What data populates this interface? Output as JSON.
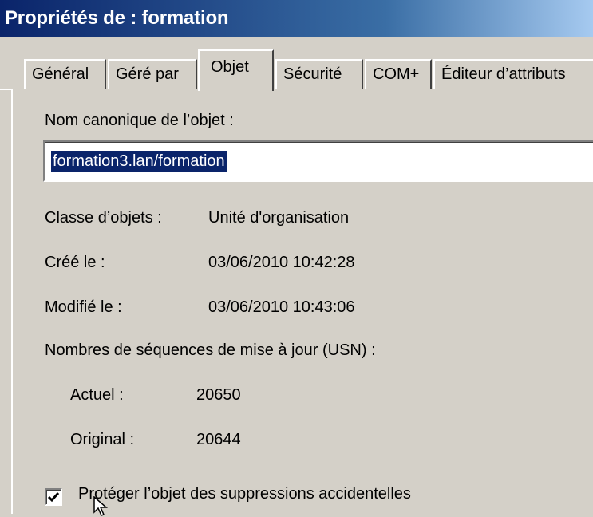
{
  "window": {
    "title": "Propriétés de : formation"
  },
  "tabs": [
    {
      "label": "Général"
    },
    {
      "label": "Géré par"
    },
    {
      "label": "Objet"
    },
    {
      "label": "Sécurité"
    },
    {
      "label": "COM+"
    },
    {
      "label": "Éditeur d’attributs"
    }
  ],
  "active_tab": "Objet",
  "canonical": {
    "label": "Nom canonique de l’objet :",
    "value": "formation3.lan/formation"
  },
  "properties": {
    "class_label": "Classe d’objets :",
    "class_value": "Unité d'organisation",
    "created_label": "Créé le :",
    "created_value": "03/06/2010 10:42:28",
    "modified_label": "Modifié le :",
    "modified_value": "03/06/2010 10:43:06"
  },
  "usn": {
    "heading": "Nombres de séquences de mise à jour (USN) :",
    "current_label": "Actuel :",
    "current_value": "20650",
    "original_label": "Original :",
    "original_value": "20644"
  },
  "protect": {
    "label": "Protéger l’objet des suppressions accidentelles",
    "checked": true
  }
}
